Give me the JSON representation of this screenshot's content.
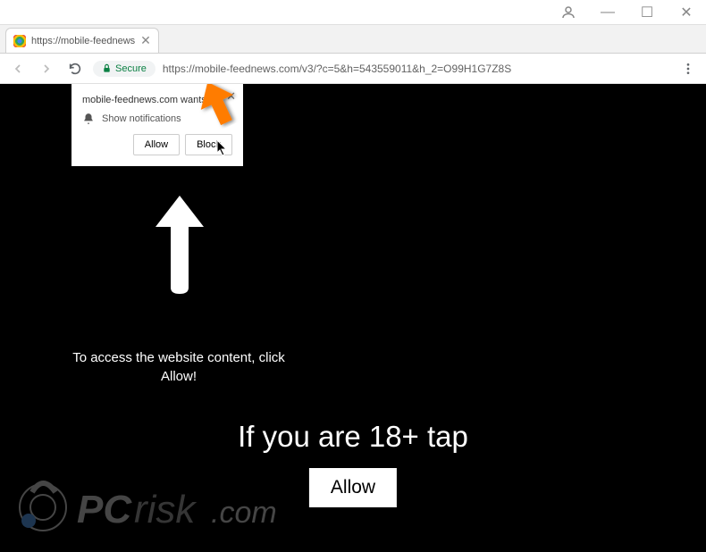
{
  "titlebar": {
    "minimize": "—",
    "maximize": "☐",
    "close": "✕"
  },
  "tab": {
    "title": "https://mobile-feednews",
    "close": "✕"
  },
  "addrbar": {
    "secure_label": "Secure",
    "url_display": "https://mobile-feednews.com/v3/?c=5&h=543559011&h_2=O99H1G7Z8S"
  },
  "notification": {
    "site": "mobile-feednews.com wants to",
    "action": "Show notifications",
    "allow": "Allow",
    "block": "Block",
    "close": "✕"
  },
  "page": {
    "access_text": "To access the website content, click Allow!",
    "main_text": "If you are 18+ tap",
    "allow_button": "Allow"
  },
  "watermark": {
    "text": "PCrisk.com"
  }
}
